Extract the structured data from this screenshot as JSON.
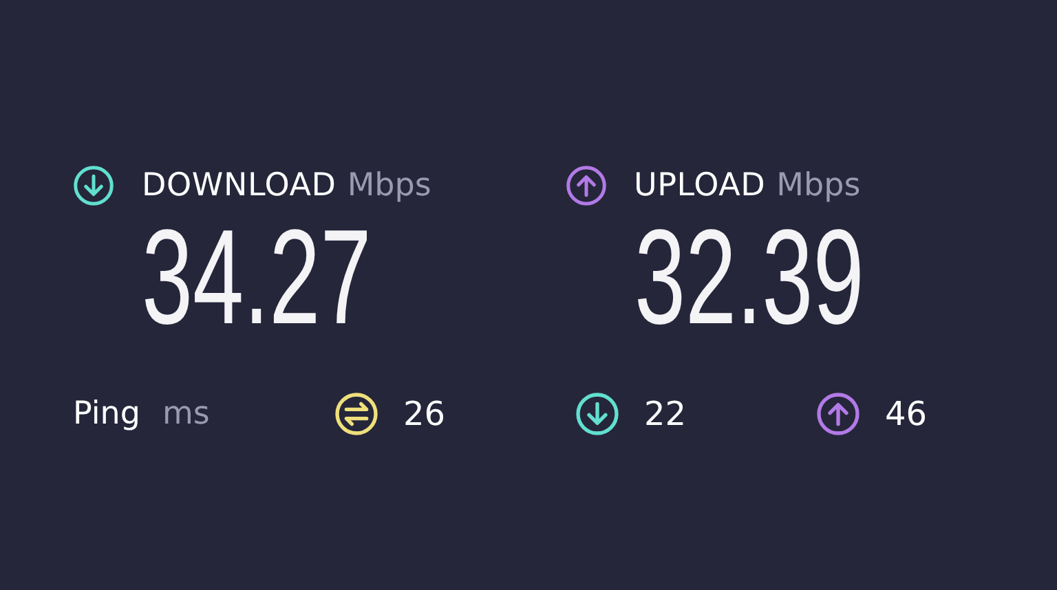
{
  "results": [
    {
      "kind": "download",
      "label": "DOWNLOAD",
      "unit": "Mbps",
      "value": "34.27",
      "color": "#62dfcf"
    },
    {
      "kind": "upload",
      "label": "UPLOAD",
      "unit": "Mbps",
      "value": "32.39",
      "color": "#b27ae6"
    }
  ],
  "ping": {
    "label": "Ping",
    "unit": "ms",
    "readings": [
      {
        "kind": "ping",
        "value": "26",
        "color": "#efe07c"
      },
      {
        "kind": "download",
        "value": "22",
        "color": "#62dfcf"
      },
      {
        "kind": "upload",
        "value": "46",
        "color": "#b27ae6"
      }
    ]
  }
}
